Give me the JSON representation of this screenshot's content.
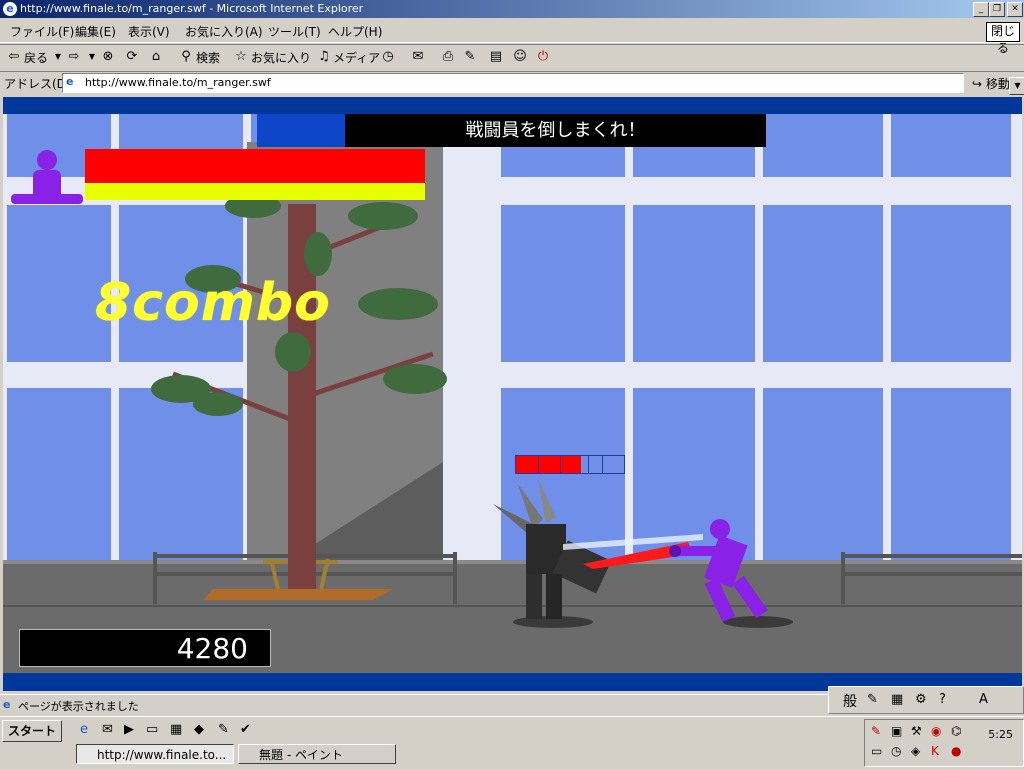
{
  "window": {
    "title": "http://www.finale.to/m_ranger.swf - Microsoft Internet Explorer",
    "close_label": "閉じる"
  },
  "menu": [
    "ファイル(F)",
    "編集(E)",
    "表示(V)",
    "お気に入り(A)",
    "ツール(T)",
    "ヘルプ(H)"
  ],
  "toolbar": {
    "back": "戻る",
    "search": "検索",
    "favorites": "お気に入り",
    "media": "メディア"
  },
  "address": {
    "label": "アドレス(D)",
    "url": "http://www.finale.to/m_ranger.swf",
    "go": "移動"
  },
  "game": {
    "banner": "戦闘員を倒しまくれ！",
    "combo": "8combo",
    "score": "4280",
    "enemy_hp_fraction": 0.6,
    "colors": {
      "sky": "#6f8fe8",
      "frame": "#e7e9f6",
      "hp_red": "#ff0000",
      "hp_yellow": "#e7ff00",
      "ranger": "#8a21e6"
    }
  },
  "status": {
    "text": "ページが表示されました"
  },
  "ime": {
    "mode": "般"
  },
  "taskbar": {
    "start": "スタート",
    "tasks": [
      "http://www.finale.to...",
      "無題 - ペイント"
    ],
    "clock": "5:25"
  }
}
